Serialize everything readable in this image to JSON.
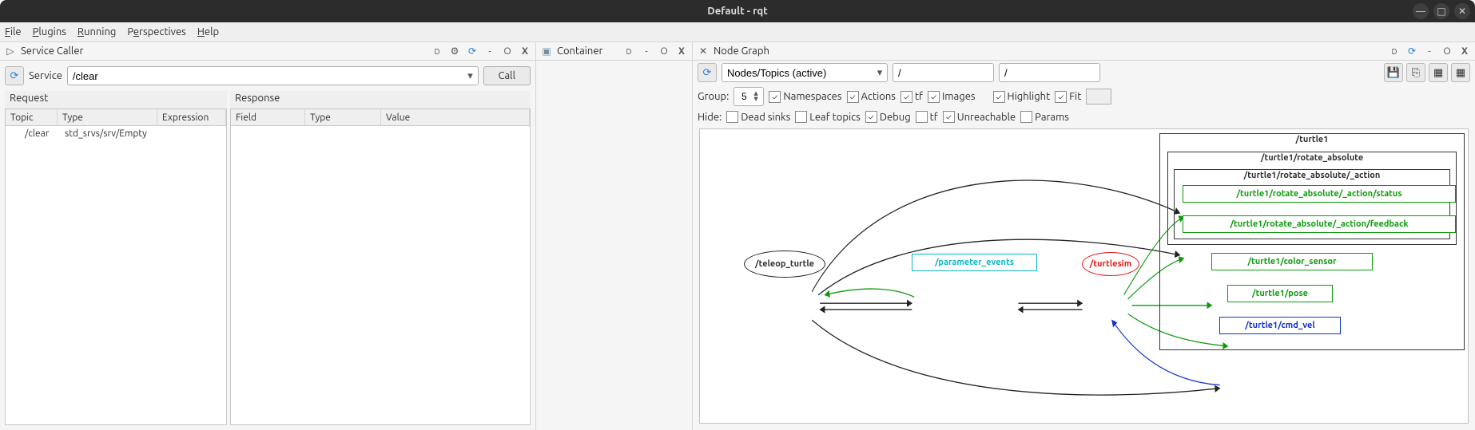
{
  "window": {
    "title": "Default - rqt"
  },
  "menubar": {
    "file": "File",
    "plugins": "Plugins",
    "running": "Running",
    "perspectives": "Perspectives",
    "help": "Help"
  },
  "panes": {
    "service_caller": {
      "title": "Service Caller",
      "service_label": "Service",
      "service_value": "/clear",
      "call": "Call",
      "request_label": "Request",
      "response_label": "Response",
      "req_headers": {
        "topic": "Topic",
        "type": "Type",
        "expr": "Expression"
      },
      "req_row": {
        "topic": "/clear",
        "type": "std_srvs/srv/Empty",
        "expr": ""
      },
      "resp_headers": {
        "field": "Field",
        "type": "Type",
        "value": "Value"
      }
    },
    "container": {
      "title": "Container"
    },
    "node_graph": {
      "title": "Node Graph",
      "combo": "Nodes/Topics (active)",
      "filter1": "/",
      "filter2": "/",
      "row2": {
        "group": "Group:",
        "group_val": "5",
        "namespaces": "Namespaces",
        "actions": "Actions",
        "tf": "tf",
        "images": "Images",
        "highlight": "Highlight",
        "fit": "Fit"
      },
      "row3": {
        "hide": "Hide:",
        "dead": "Dead sinks",
        "leaf": "Leaf topics",
        "debug": "Debug",
        "tf": "tf",
        "unreach": "Unreachable",
        "params": "Params"
      },
      "graph": {
        "cluster1": "/turtle1",
        "cluster2": "/turtle1/rotate_absolute",
        "cluster3": "/turtle1/rotate_absolute/_action",
        "t_status": "/turtle1/rotate_absolute/_action/status",
        "t_feedback": "/turtle1/rotate_absolute/_action/feedback",
        "t_color": "/turtle1/color_sensor",
        "t_pose": "/turtle1/pose",
        "t_cmd": "/turtle1/cmd_vel",
        "n_teleop": "/teleop_turtle",
        "n_param": "/parameter_events",
        "n_turtlesim": "/turtlesim"
      }
    }
  }
}
